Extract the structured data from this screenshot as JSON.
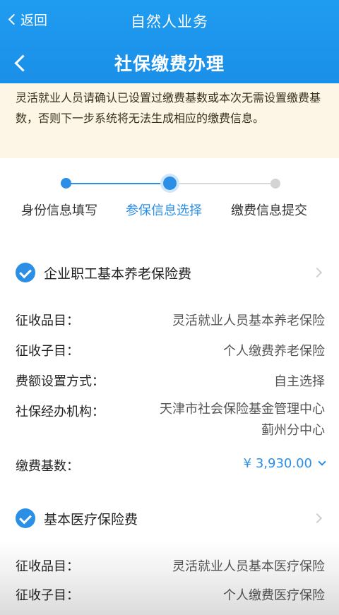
{
  "header": {
    "back_label": "返回",
    "app_title": "自然人业务",
    "page_title": "社保缴费办理"
  },
  "notice": {
    "text": "灵活就业人员请确认已设置过缴费基数或本次无需设置缴费基数，否则下一步系统将无法生成相应的缴费信息。"
  },
  "steps": [
    {
      "label": "身份信息填写",
      "state": "done"
    },
    {
      "label": "参保信息选择",
      "state": "current"
    },
    {
      "label": "缴费信息提交",
      "state": "todo"
    }
  ],
  "sections": [
    {
      "title": "企业职工基本养老保险费",
      "checked": true,
      "rows": [
        {
          "key": "征收品目：",
          "value": "灵活就业人员基本养老保险"
        },
        {
          "key": "征收子目：",
          "value": "个人缴费养老保险"
        },
        {
          "key": "费额设置方式：",
          "value": "自主选择"
        },
        {
          "key": "社保经办机构：",
          "value_line1": "天津市社会保险基金管理中心",
          "value_line2": "蓟州分中心"
        },
        {
          "key": "缴费基数：",
          "value": "¥ 3,930.00"
        }
      ]
    },
    {
      "title": "基本医疗保险费",
      "checked": true,
      "rows": [
        {
          "key": "征收品目：",
          "value": "灵活就业人员基本医疗保险"
        },
        {
          "key": "征收子目：",
          "value": "个人缴费医疗保险"
        }
      ]
    }
  ],
  "colors": {
    "header_blue": "#1f9cf0",
    "accent_blue": "#2b8fe6",
    "notice_bg": "#fdf6e6"
  }
}
